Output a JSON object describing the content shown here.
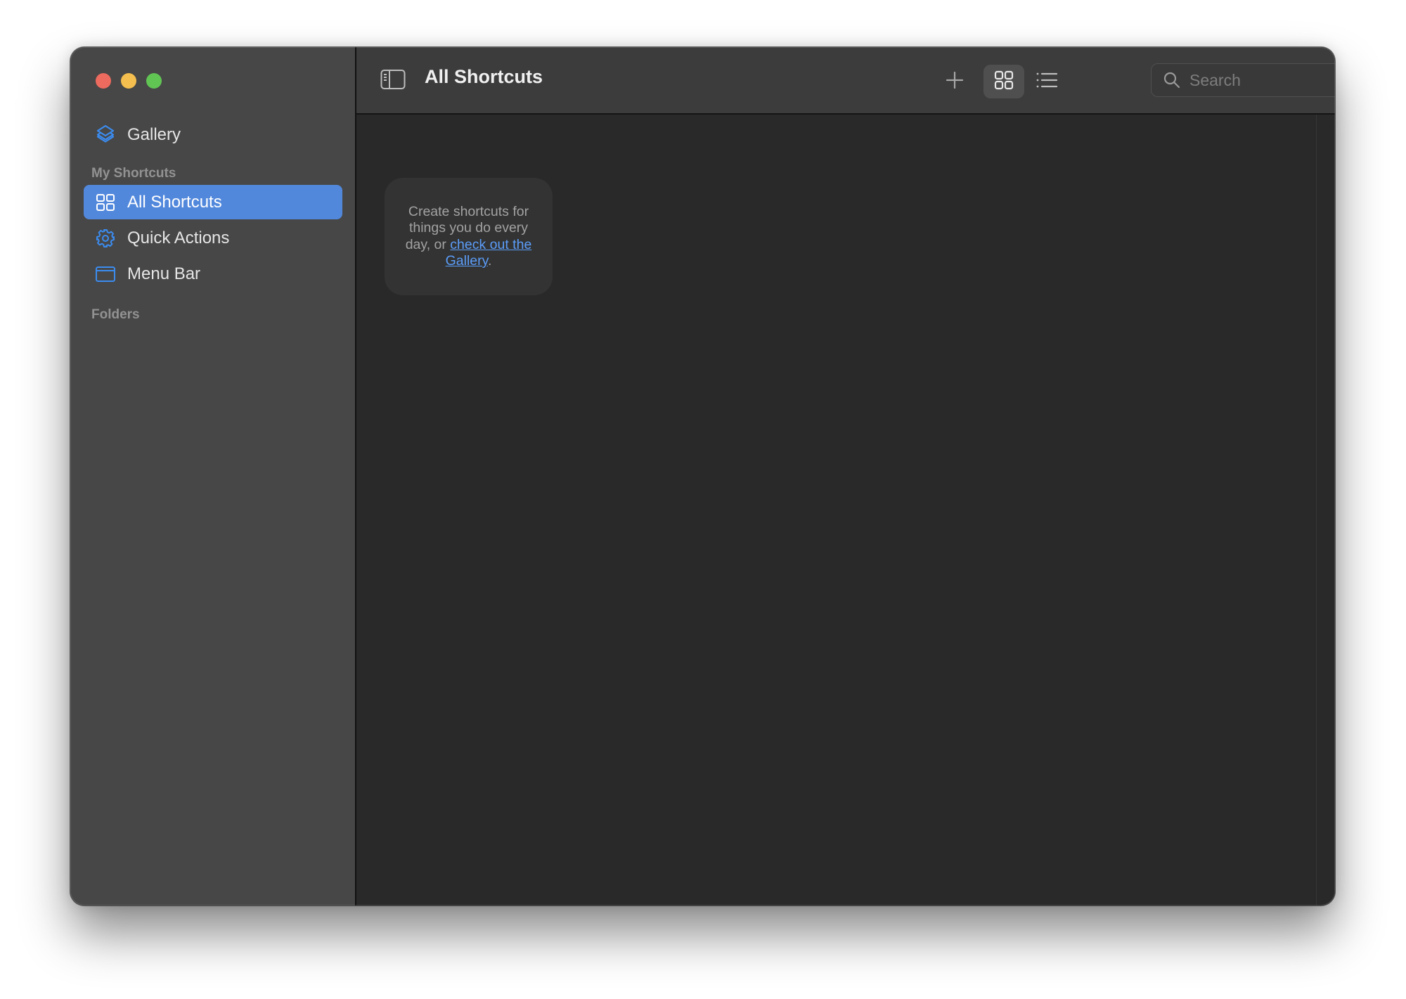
{
  "window": {
    "traffic_lights": [
      "close",
      "minimize",
      "zoom"
    ]
  },
  "sidebar": {
    "gallery": {
      "label": "Gallery",
      "icon": "gallery-stack-icon"
    },
    "sections": [
      {
        "header": "My Shortcuts",
        "items": [
          {
            "label": "All Shortcuts",
            "icon": "grid-icon",
            "selected": true
          },
          {
            "label": "Quick Actions",
            "icon": "gear-icon",
            "selected": false
          },
          {
            "label": "Menu Bar",
            "icon": "menubar-window-icon",
            "selected": false
          }
        ]
      },
      {
        "header": "Folders",
        "items": []
      }
    ]
  },
  "toolbar": {
    "title": "All Shortcuts",
    "sidebar_toggle_icon": "sidebar-toggle-icon",
    "add_icon": "plus-icon",
    "grid_view_icon": "grid-view-icon",
    "list_view_icon": "list-view-icon",
    "active_view": "grid",
    "search": {
      "placeholder": "Search",
      "value": ""
    }
  },
  "main": {
    "empty_state": {
      "text_before": "Create shortcuts for things you do every day, or ",
      "link_text": "check out the Gallery",
      "text_after": "."
    }
  },
  "colors": {
    "accent": "#5288dc",
    "link": "#5c9dfa",
    "icon_blue": "#3b8cf0",
    "close": "#ed6a5e",
    "minimize": "#f5bf4f",
    "zoom": "#61c554"
  }
}
